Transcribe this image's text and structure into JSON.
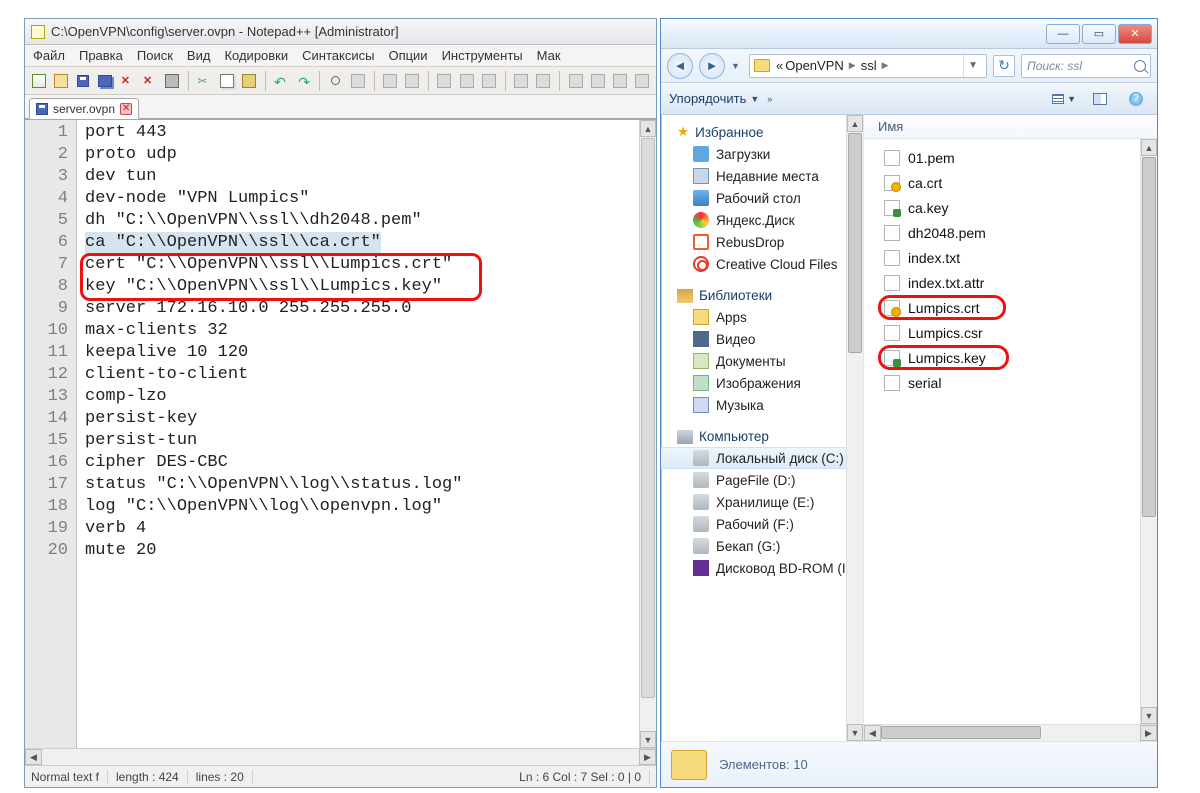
{
  "notepadpp": {
    "title": "C:\\OpenVPN\\config\\server.ovpn - Notepad++ [Administrator]",
    "menu": [
      "Файл",
      "Правка",
      "Поиск",
      "Вид",
      "Кодировки",
      "Синтаксисы",
      "Опции",
      "Инструменты",
      "Мак"
    ],
    "tab": {
      "name": "server.ovpn"
    },
    "code_lines": [
      "port 443",
      "proto udp",
      "dev tun",
      "dev-node \"VPN Lumpics\"",
      "dh \"C:\\\\OpenVPN\\\\ssl\\\\dh2048.pem\"",
      "ca \"C:\\\\OpenVPN\\\\ssl\\\\ca.crt\"",
      "cert \"C:\\\\OpenVPN\\\\ssl\\\\Lumpics.crt\"",
      "key \"C:\\\\OpenVPN\\\\ssl\\\\Lumpics.key\"",
      "server 172.16.10.0 255.255.255.0",
      "max-clients 32",
      "keepalive 10 120",
      "client-to-client",
      "comp-lzo",
      "persist-key",
      "persist-tun",
      "cipher DES-CBC",
      "status \"C:\\\\OpenVPN\\\\log\\\\status.log\"",
      "log \"C:\\\\OpenVPN\\\\log\\\\openvpn.log\"",
      "verb 4",
      "mute 20"
    ],
    "highlighted_line_index": 5,
    "status": {
      "lang": "Normal text f",
      "length": "length : 424",
      "lines": "lines : 20",
      "pos": "Ln : 6    Col : 7    Sel : 0 | 0"
    }
  },
  "explorer": {
    "breadcrumb": {
      "root_prefix": "«",
      "parent": "OpenVPN",
      "current": "ssl"
    },
    "search_placeholder": "Поиск: ssl",
    "cmdbar": {
      "organize": "Упорядочить",
      "overflow": "»"
    },
    "navpanel": {
      "favorites_header": "Избранное",
      "favorites": [
        "Загрузки",
        "Недавние места",
        "Рабочий стол",
        "Яндекс.Диск",
        "RebusDrop",
        "Creative Cloud Files"
      ],
      "libraries_header": "Библиотеки",
      "libraries": [
        "Apps",
        "Видео",
        "Документы",
        "Изображения",
        "Музыка"
      ],
      "computer_header": "Компьютер",
      "drives": [
        "Локальный диск (C:)",
        "PageFile (D:)",
        "Хранилище (E:)",
        "Рабочий (F:)",
        "Бекап (G:)",
        "Дисковод BD-ROM (I"
      ]
    },
    "filepanel": {
      "column_header": "Имя",
      "files": [
        {
          "name": "01.pem",
          "type": "txt"
        },
        {
          "name": "ca.crt",
          "type": "cert"
        },
        {
          "name": "ca.key",
          "type": "key"
        },
        {
          "name": "dh2048.pem",
          "type": "txt"
        },
        {
          "name": "index.txt",
          "type": "txt"
        },
        {
          "name": "index.txt.attr",
          "type": "gen"
        },
        {
          "name": "Lumpics.crt",
          "type": "cert",
          "highlight": true
        },
        {
          "name": "Lumpics.csr",
          "type": "gen"
        },
        {
          "name": "Lumpics.key",
          "type": "key",
          "highlight": true
        },
        {
          "name": "serial",
          "type": "gen"
        }
      ]
    },
    "details": "Элементов: 10"
  }
}
